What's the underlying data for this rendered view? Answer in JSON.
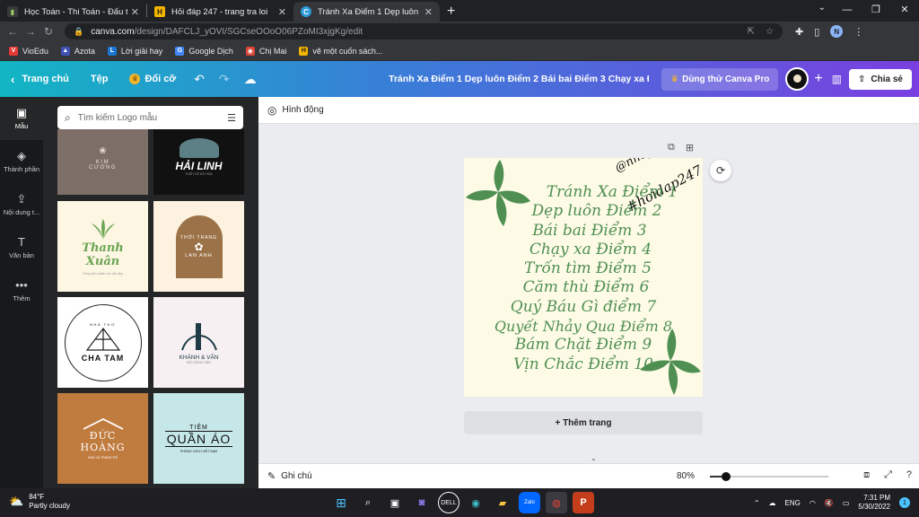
{
  "browser": {
    "tabs": [
      {
        "title": "Học Toán - Thi Toán - Đấu trường",
        "favicon": "V",
        "color": "#2a2a2a"
      },
      {
        "title": "Hỏi đáp 247 - trang tra loi",
        "favicon": "H",
        "color": "#f4b400"
      },
      {
        "title": "Tránh Xa Điểm 1 Dẹp luôn Điểm",
        "favicon": "C",
        "color": "#2d9cdb"
      }
    ],
    "url_host": "canva.com",
    "url_path": "/design/DAFCLJ_yOVI/SGCseOOoO06PZoMI3xjgKg/edit",
    "profile_initial": "N",
    "bookmarks": [
      {
        "label": "VioEdu",
        "color": "#e53935",
        "glyph": "V"
      },
      {
        "label": "Azota",
        "color": "#3f51b5",
        "glyph": "▲"
      },
      {
        "label": "Lời giải hay",
        "color": "#1976d2",
        "glyph": "L"
      },
      {
        "label": "Google Dịch",
        "color": "#4285f4",
        "glyph": "G"
      },
      {
        "label": "Chị Mai",
        "color": "#f4b400",
        "glyph": "◉"
      },
      {
        "label": "vẽ một cuốn sách...",
        "color": "#f4b400",
        "glyph": "H"
      }
    ]
  },
  "canva": {
    "home": "Trang chủ",
    "file": "Tệp",
    "resize": "Đổi cỡ",
    "doc_title": "Tránh Xa Điểm 1 Dẹp luôn Điểm 2 Bái bai Điểm 3 Chạy xa Đi...",
    "pro": "Dùng thử Canva Pro",
    "share": "Chia sẻ",
    "rail": [
      {
        "label": "Mẫu",
        "icon": "layout-icon",
        "glyph": "▣"
      },
      {
        "label": "Thành phần",
        "icon": "elements-icon",
        "glyph": "◈"
      },
      {
        "label": "Nội dung t...",
        "icon": "upload-icon",
        "glyph": "⇪"
      },
      {
        "label": "Văn bản",
        "icon": "text-icon",
        "glyph": "T"
      },
      {
        "label": "Thêm",
        "icon": "more-icon",
        "glyph": "•••"
      }
    ],
    "search_placeholder": "Tìm kiếm Logo mẫu",
    "templates": [
      {
        "line1": "KIM",
        "line2": "CƯƠNG"
      },
      {
        "line1": "HẢI LINH",
        "line2": "THIẾT KẾ ĐỒ HOẠ"
      },
      {
        "line1": "Thanh",
        "line2": "Xuân",
        "line3": "Trung tâm chăm sóc sắc đẹp"
      },
      {
        "line1": "THỜI TRANG",
        "line2": "LAN ANH"
      },
      {
        "line1": "NHÀ THƠ",
        "line2": "CHA TAM"
      },
      {
        "line1": "KHÁNH & VÂN",
        "line2": "BẤT ĐỘNG SẢN"
      },
      {
        "line1": "ĐỨC",
        "line2": "HOÀNG",
        "line3": "NHÀ VÀ TRANG TRÍ"
      },
      {
        "line1": "TIỆM",
        "line2": "QUẦN ÁO",
        "line3": "PHONG CÁCH VIỆT NAM"
      }
    ],
    "animate": "Hình động",
    "add_page": "+ Thêm trang",
    "notes": "Ghi chú",
    "zoom": "80%",
    "zoom_fraction": 0.14,
    "design": {
      "handle": "@nnuyen",
      "hashtag": "#hoidap247",
      "lines": [
        "Tránh Xa Điểm 1",
        "Dẹp luôn Điểm 2",
        "Bái bai Điểm 3",
        "Chạy xa Điểm 4",
        "Trốn tìm Điểm 5",
        "Căm thù Điểm 6",
        "Quý Báu Gì điểm 7",
        "Quyết Nhảy Qua Điểm 8",
        "Bám Chặt Điểm 9",
        "Vịn Chắc Điểm 10"
      ]
    }
  },
  "taskbar": {
    "temp": "84°F",
    "weather": "Partly cloudy",
    "lang": "ENG",
    "time": "7:31 PM",
    "date": "5/30/2022"
  }
}
